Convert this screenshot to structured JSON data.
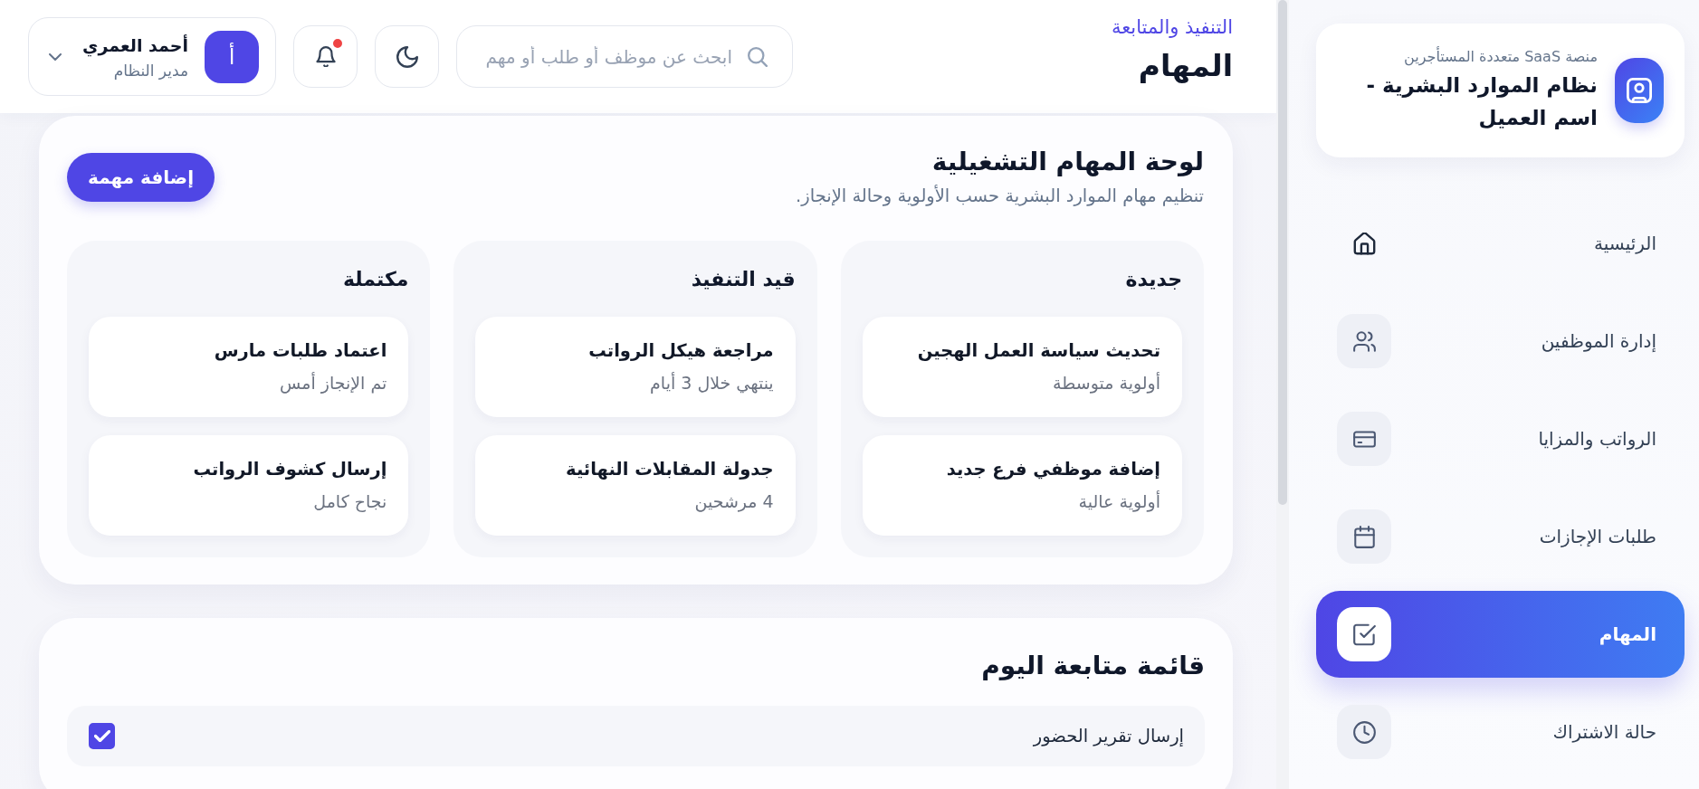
{
  "sidebar": {
    "brand": {
      "subtitle": "منصة SaaS متعددة المستأجرين",
      "title": "نظام الموارد البشرية - اسم العميل"
    },
    "items": [
      {
        "label": "الرئيسية",
        "kind": "bare",
        "selected": false
      },
      {
        "label": "إدارة الموظفين",
        "kind": "tile",
        "selected": false
      },
      {
        "label": "الرواتب والمزايا",
        "kind": "tile",
        "selected": false
      },
      {
        "label": "طلبات الإجازات",
        "kind": "tile",
        "selected": false
      },
      {
        "label": "المهام",
        "kind": "tile",
        "selected": true
      },
      {
        "label": "حالة الاشتراك",
        "kind": "tile",
        "selected": false
      }
    ]
  },
  "header": {
    "breadcrumb": "التنفيذ والمتابعة",
    "title": "المهام",
    "search": {
      "placeholder": "ابحث عن موظف أو طلب أو مهم"
    },
    "notifications": {
      "unread": true
    },
    "user": {
      "initial": "أ",
      "name": "أحمد العمري",
      "role": "مدير النظام"
    }
  },
  "board": {
    "title": "لوحة المهام التشغيلية",
    "subtitle": "تنظيم مهام الموارد البشرية حسب الأولوية وحالة الإنجاز.",
    "add_button": "إضافة مهمة",
    "columns": [
      {
        "title": "جديدة",
        "tasks": [
          {
            "title": "تحديث سياسة العمل الهجين",
            "meta": "أولوية متوسطة"
          },
          {
            "title": "إضافة موظفي فرع جديد",
            "meta": "أولوية عالية"
          }
        ]
      },
      {
        "title": "قيد التنفيذ",
        "tasks": [
          {
            "title": "مراجعة هيكل الرواتب",
            "meta": "ينتهي خلال 3 أيام"
          },
          {
            "title": "جدولة المقابلات النهائية",
            "meta": "4 مرشحين"
          }
        ]
      },
      {
        "title": "مكتملة",
        "tasks": [
          {
            "title": "اعتماد طلبات مارس",
            "meta": "تم الإنجاز أمس"
          },
          {
            "title": "إرسال كشوف الرواتب",
            "meta": "نجاح كامل"
          }
        ]
      }
    ]
  },
  "checklist": {
    "title": "قائمة متابعة اليوم",
    "items": [
      {
        "label": "إرسال تقرير الحضور",
        "checked": true
      }
    ]
  }
}
